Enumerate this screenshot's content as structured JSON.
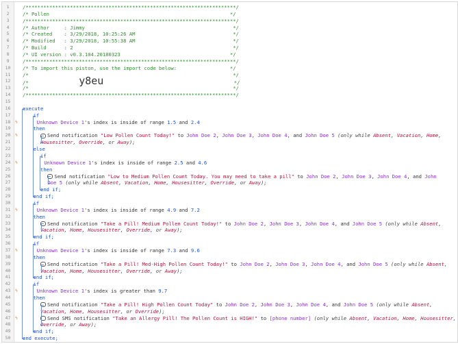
{
  "gutter_symbol": "ϟ",
  "lines": [
    {
      "n": "1",
      "f": false,
      "x": 0,
      "s": [
        [
          "/***********************************************************************/",
          "cm"
        ]
      ]
    },
    {
      "n": "2",
      "f": false,
      "x": 0,
      "s": [
        [
          "/* Pollen                                                             */",
          "cm"
        ]
      ]
    },
    {
      "n": "3",
      "f": false,
      "x": 0,
      "s": [
        [
          "/***********************************************************************/",
          "cm"
        ]
      ]
    },
    {
      "n": "4",
      "f": false,
      "x": 0,
      "s": [
        [
          "/* Author     : Jimmy                                                  */",
          "cm"
        ]
      ]
    },
    {
      "n": "5",
      "f": false,
      "x": 0,
      "s": [
        [
          "/* Created    : 3/29/2018, 10:25:26 AM                                 */",
          "cm"
        ]
      ]
    },
    {
      "n": "6",
      "f": false,
      "x": 0,
      "s": [
        [
          "/* Modified   : 3/29/2018, 10:55:38 AM                                 */",
          "cm"
        ]
      ]
    },
    {
      "n": "7",
      "f": false,
      "x": 0,
      "s": [
        [
          "/* Build      : 2                                                      */",
          "cm"
        ]
      ]
    },
    {
      "n": "8",
      "f": false,
      "x": 0,
      "s": [
        [
          "/* UI version : v0.3.104.20180323                                     */",
          "cm"
        ]
      ]
    },
    {
      "n": "9",
      "f": false,
      "x": 0,
      "s": [
        [
          "/***********************************************************************/",
          "cm"
        ]
      ]
    },
    {
      "n": "10",
      "f": false,
      "x": 0,
      "s": [
        [
          "/* To import this piston, use the import code below:                  */",
          "cm"
        ]
      ]
    },
    {
      "n": "11",
      "f": false,
      "x": 0,
      "s": [
        [
          "/*                                                                     */",
          "cm"
        ]
      ]
    },
    {
      "n": "12",
      "f": false,
      "x": 0,
      "s": [
        [
          "/*                 ",
          "cm"
        ],
        [
          "y8eu",
          "big"
        ],
        [
          "                                            */",
          "cm"
        ]
      ]
    },
    {
      "n": "13",
      "f": false,
      "x": 0,
      "s": [
        [
          "/*                                                                     */",
          "cm"
        ]
      ]
    },
    {
      "n": "14",
      "f": false,
      "x": 0,
      "s": [
        [
          "/***********************************************************************/",
          "cm"
        ]
      ]
    },
    {
      "n": "15",
      "f": false,
      "x": 0,
      "s": []
    },
    {
      "n": "16",
      "f": false,
      "x": 0,
      "s": [
        [
          "execute",
          "kw"
        ]
      ]
    },
    {
      "n": "17",
      "f": false,
      "x": 3,
      "s": [
        [
          "if",
          "kw"
        ]
      ]
    },
    {
      "n": "18",
      "f": true,
      "x": 4,
      "s": [
        [
          "Unknown Device 1",
          "dev"
        ],
        [
          "'s index is inside of range ",
          ""
        ],
        [
          "1.5",
          "num"
        ],
        [
          " and ",
          ""
        ],
        [
          "2.4",
          "num"
        ]
      ]
    },
    {
      "n": "19",
      "f": false,
      "x": 3,
      "s": [
        [
          "then",
          "kw"
        ]
      ]
    },
    {
      "n": "20",
      "f": true,
      "x": 5,
      "b": true,
      "s": [
        [
          "Send notification ",
          ""
        ],
        [
          "\"Low Pollen Count Today!\"",
          "str"
        ],
        [
          " to ",
          ""
        ],
        [
          "John Doe 2",
          "dev"
        ],
        [
          ", ",
          ""
        ],
        [
          "John Doe 3",
          "dev"
        ],
        [
          ", ",
          ""
        ],
        [
          "John Doe 4",
          "dev"
        ],
        [
          ", and ",
          ""
        ],
        [
          "John Doe 5",
          "dev"
        ],
        [
          " (only while ",
          "itl"
        ],
        [
          "Absent",
          "mode"
        ],
        [
          ", ",
          "itl"
        ],
        [
          "Vacation",
          "mode"
        ],
        [
          ", ",
          "itl"
        ],
        [
          "Home",
          "mode"
        ],
        [
          ",",
          "itl"
        ]
      ]
    },
    {
      "n": "21",
      "f": false,
      "x": 5,
      "s": [
        [
          "Housesitter",
          "mode"
        ],
        [
          ", ",
          "itl"
        ],
        [
          "Override",
          "mode"
        ],
        [
          ", or ",
          "itl"
        ],
        [
          "Away",
          "mode"
        ],
        [
          ");",
          "itl"
        ]
      ]
    },
    {
      "n": "22",
      "f": false,
      "x": 3,
      "s": [
        [
          "else",
          "kw"
        ]
      ]
    },
    {
      "n": "23",
      "f": false,
      "x": 5,
      "s": [
        [
          "if",
          "kw"
        ]
      ]
    },
    {
      "n": "24",
      "f": true,
      "x": 6,
      "s": [
        [
          "Unknown Device 1",
          "dev"
        ],
        [
          "'s index is inside of range ",
          ""
        ],
        [
          "2.5",
          "num"
        ],
        [
          " and ",
          ""
        ],
        [
          "4.6",
          "num"
        ]
      ]
    },
    {
      "n": "25",
      "f": false,
      "x": 5,
      "s": [
        [
          "then",
          "kw"
        ]
      ]
    },
    {
      "n": "26",
      "f": false,
      "x": 7,
      "b": true,
      "s": [
        [
          "Send notification ",
          ""
        ],
        [
          "\"Low to Medium Pollen Count Today. You may need to take a pill\"",
          "str"
        ],
        [
          " to ",
          ""
        ],
        [
          "John Doe 2",
          "dev"
        ],
        [
          ", ",
          ""
        ],
        [
          "John Doe 3",
          "dev"
        ],
        [
          ", ",
          ""
        ],
        [
          "John Doe 4",
          "dev"
        ],
        [
          ", and ",
          ""
        ],
        [
          "John",
          "dev"
        ]
      ]
    },
    {
      "n": "27",
      "f": false,
      "x": 7,
      "s": [
        [
          "Doe 5",
          "dev"
        ],
        [
          " (only while ",
          "itl"
        ],
        [
          "Absent",
          "mode"
        ],
        [
          ", ",
          "itl"
        ],
        [
          "Vacation",
          "mode"
        ],
        [
          ", ",
          "itl"
        ],
        [
          "Home",
          "mode"
        ],
        [
          ", ",
          "itl"
        ],
        [
          "Housesitter",
          "mode"
        ],
        [
          ", ",
          "itl"
        ],
        [
          "Override",
          "mode"
        ],
        [
          ", or ",
          "itl"
        ],
        [
          "Away",
          "mode"
        ],
        [
          ");",
          "itl"
        ]
      ]
    },
    {
      "n": "28",
      "f": false,
      "x": 5,
      "s": [
        [
          "end if;",
          "kw"
        ]
      ]
    },
    {
      "n": "29",
      "f": false,
      "x": 3,
      "s": [
        [
          "end if;",
          "kw"
        ]
      ]
    },
    {
      "n": "30",
      "f": false,
      "x": 3,
      "s": [
        [
          "if",
          "kw"
        ]
      ]
    },
    {
      "n": "31",
      "f": true,
      "x": 4,
      "s": [
        [
          "Unknown Device 1",
          "dev"
        ],
        [
          "'s index is inside of range ",
          ""
        ],
        [
          "4.9",
          "num"
        ],
        [
          " and ",
          ""
        ],
        [
          "7.2",
          "num"
        ]
      ]
    },
    {
      "n": "32",
      "f": false,
      "x": 3,
      "s": [
        [
          "then",
          "kw"
        ]
      ]
    },
    {
      "n": "33",
      "f": false,
      "x": 5,
      "b": true,
      "s": [
        [
          "Send notification ",
          ""
        ],
        [
          "\"Take a Pill! Medium Pollen Count Today!\"",
          "str"
        ],
        [
          " to ",
          ""
        ],
        [
          "John Doe 2",
          "dev"
        ],
        [
          ", ",
          ""
        ],
        [
          "John Doe 3",
          "dev"
        ],
        [
          ", ",
          ""
        ],
        [
          "John Doe 4",
          "dev"
        ],
        [
          ", and ",
          ""
        ],
        [
          "John Doe 5",
          "dev"
        ],
        [
          " (only while ",
          "itl"
        ],
        [
          "Absent",
          "mode"
        ],
        [
          ",",
          "itl"
        ]
      ]
    },
    {
      "n": "34",
      "f": false,
      "x": 5,
      "s": [
        [
          "Vacation",
          "mode"
        ],
        [
          ", ",
          "itl"
        ],
        [
          "Home",
          "mode"
        ],
        [
          ", ",
          "itl"
        ],
        [
          "Housesitter",
          "mode"
        ],
        [
          ", ",
          "itl"
        ],
        [
          "Override",
          "mode"
        ],
        [
          ", or ",
          "itl"
        ],
        [
          "Away",
          "mode"
        ],
        [
          ");",
          "itl"
        ]
      ]
    },
    {
      "n": "35",
      "f": false,
      "x": 3,
      "s": [
        [
          "end if;",
          "kw"
        ]
      ]
    },
    {
      "n": "36",
      "f": false,
      "x": 3,
      "s": [
        [
          "if",
          "kw"
        ]
      ]
    },
    {
      "n": "37",
      "f": true,
      "x": 4,
      "s": [
        [
          "Unknown Device 1",
          "dev"
        ],
        [
          "'s index is inside of range ",
          ""
        ],
        [
          "7.3",
          "num"
        ],
        [
          " and ",
          ""
        ],
        [
          "9.6",
          "num"
        ]
      ]
    },
    {
      "n": "38",
      "f": false,
      "x": 3,
      "s": [
        [
          "then",
          "kw"
        ]
      ]
    },
    {
      "n": "39",
      "f": false,
      "x": 5,
      "b": true,
      "s": [
        [
          "Send notification ",
          ""
        ],
        [
          "\"Take a Pill! Med-High Pollen Count Today!\"",
          "str"
        ],
        [
          " to ",
          ""
        ],
        [
          "John Doe 2",
          "dev"
        ],
        [
          ", ",
          ""
        ],
        [
          "John Doe 3",
          "dev"
        ],
        [
          ", ",
          ""
        ],
        [
          "John Doe 4",
          "dev"
        ],
        [
          ", and ",
          ""
        ],
        [
          "John Doe 5",
          "dev"
        ],
        [
          " (only while ",
          "itl"
        ],
        [
          "Absent",
          "mode"
        ],
        [
          ",",
          "itl"
        ]
      ]
    },
    {
      "n": "40",
      "f": false,
      "x": 5,
      "s": [
        [
          "Vacation",
          "mode"
        ],
        [
          ", ",
          "itl"
        ],
        [
          "Home",
          "mode"
        ],
        [
          ", ",
          "itl"
        ],
        [
          "Housesitter",
          "mode"
        ],
        [
          ", ",
          "itl"
        ],
        [
          "Override",
          "mode"
        ],
        [
          ", or ",
          "itl"
        ],
        [
          "Away",
          "mode"
        ],
        [
          ");",
          "itl"
        ]
      ]
    },
    {
      "n": "41",
      "f": false,
      "x": 3,
      "s": [
        [
          "end if;",
          "kw"
        ]
      ]
    },
    {
      "n": "42",
      "f": false,
      "x": 3,
      "s": [
        [
          "if",
          "kw"
        ]
      ]
    },
    {
      "n": "43",
      "f": true,
      "x": 4,
      "s": [
        [
          "Unknown Device 1",
          "dev"
        ],
        [
          "'s index is greater than ",
          ""
        ],
        [
          "9.7",
          "num"
        ]
      ]
    },
    {
      "n": "44",
      "f": false,
      "x": 3,
      "s": [
        [
          "then",
          "kw"
        ]
      ]
    },
    {
      "n": "45",
      "f": false,
      "x": 5,
      "b": true,
      "s": [
        [
          "Send notification ",
          ""
        ],
        [
          "\"Take a Pill! High Pollen Count Today\"",
          "str"
        ],
        [
          " to ",
          ""
        ],
        [
          "John Doe 2",
          "dev"
        ],
        [
          ", ",
          ""
        ],
        [
          "John Doe 3",
          "dev"
        ],
        [
          ", ",
          ""
        ],
        [
          "John Doe 4",
          "dev"
        ],
        [
          ", and ",
          ""
        ],
        [
          "John Doe 5",
          "dev"
        ],
        [
          " (only while ",
          "itl"
        ],
        [
          "Absent",
          "mode"
        ],
        [
          ",",
          "itl"
        ]
      ]
    },
    {
      "n": "46",
      "f": false,
      "x": 5,
      "s": [
        [
          "Vacation",
          "mode"
        ],
        [
          ", ",
          "itl"
        ],
        [
          "Home",
          "mode"
        ],
        [
          ", ",
          "itl"
        ],
        [
          "Housesitter",
          "mode"
        ],
        [
          ", or ",
          "itl"
        ],
        [
          "Override",
          "mode"
        ],
        [
          ");",
          "itl"
        ]
      ]
    },
    {
      "n": "47",
      "f": true,
      "x": 5,
      "b": true,
      "s": [
        [
          "Send SMS notification ",
          ""
        ],
        [
          "\"Take an Allergy Pill! The Pollen Count is HIGH!\"",
          "str"
        ],
        [
          " to ",
          ""
        ],
        [
          "[phone number]",
          "dev"
        ],
        [
          " (only while ",
          "itl"
        ],
        [
          "Absent",
          "mode"
        ],
        [
          ", ",
          "itl"
        ],
        [
          "Vacation",
          "mode"
        ],
        [
          ", ",
          "itl"
        ],
        [
          "Home",
          "mode"
        ],
        [
          ", ",
          "itl"
        ],
        [
          "Housesitter",
          "mode"
        ],
        [
          ",",
          "itl"
        ]
      ]
    },
    {
      "n": "48",
      "f": false,
      "x": 5,
      "s": [
        [
          "Override",
          "mode"
        ],
        [
          ", or ",
          "itl"
        ],
        [
          "Away",
          "mode"
        ],
        [
          ");",
          "itl"
        ]
      ]
    },
    {
      "n": "49",
      "f": false,
      "x": 3,
      "s": [
        [
          "end if;",
          "kw"
        ]
      ]
    },
    {
      "n": "50",
      "f": false,
      "x": 0,
      "s": [
        [
          "end execute;",
          "kw"
        ]
      ]
    }
  ]
}
